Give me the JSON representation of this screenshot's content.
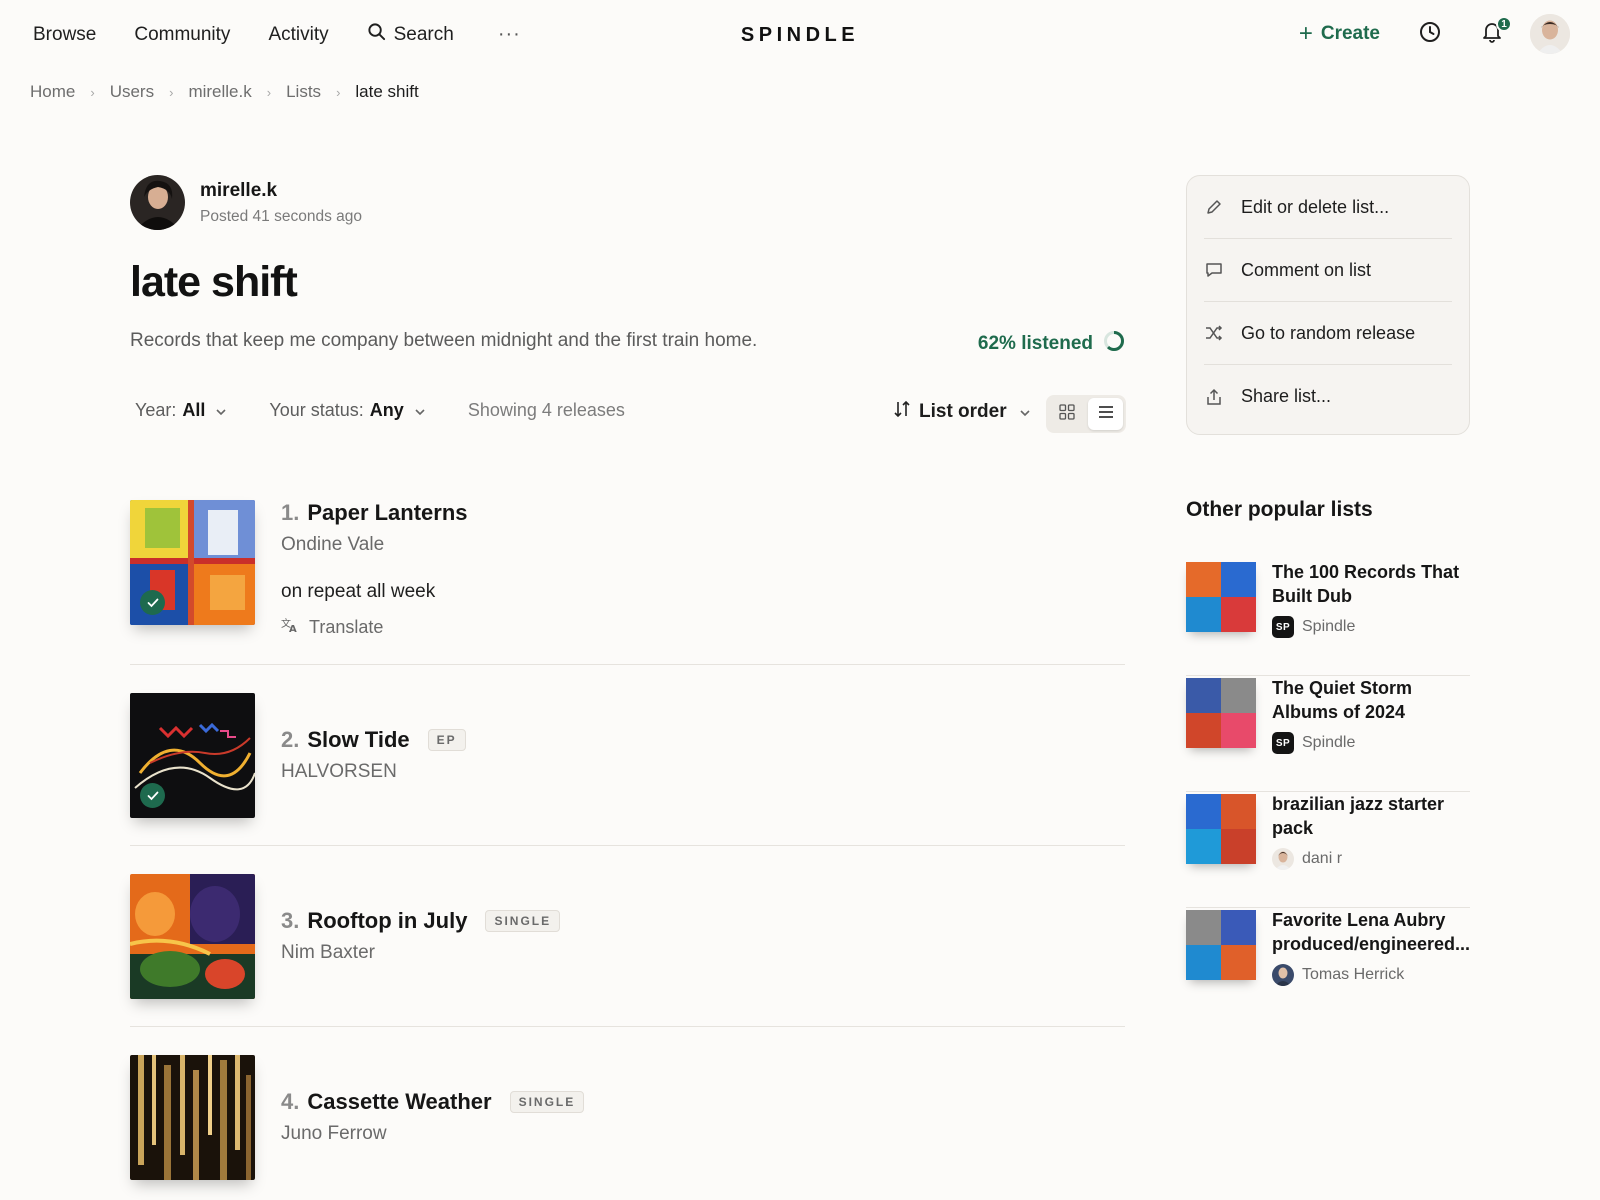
{
  "nav": {
    "browse": "Browse",
    "community": "Community",
    "activity": "Activity",
    "search": "Search",
    "more": "···",
    "logo": "SPINDLE",
    "create": "Create",
    "notification_count": "1"
  },
  "breadcrumb": {
    "items": [
      "Home",
      "Users",
      "mirelle.k",
      "Lists"
    ],
    "current": "late shift"
  },
  "list": {
    "author": "mirelle.k",
    "posted": "Posted 41 seconds ago",
    "title": "late shift",
    "description": "Records that keep me company between midnight and the first train home.",
    "progress_label": "62% listened",
    "progress_value": 0.62
  },
  "filters": {
    "year_label": "Year:",
    "year_value": "All",
    "status_label": "Your status:",
    "status_value": "Any",
    "showing": "Showing 4 releases",
    "sort": "List order",
    "view_mode": "list"
  },
  "releases": [
    {
      "num": "1.",
      "title": "Paper Lanterns",
      "artist": "Ondine Vale",
      "badge": "",
      "listened": true,
      "note": "on repeat all week",
      "translate": "Translate"
    },
    {
      "num": "2.",
      "title": "Slow Tide",
      "artist": "HALVORSEN",
      "badge": "EP",
      "listened": true
    },
    {
      "num": "3.",
      "title": "Rooftop in July",
      "artist": "Nim Baxter",
      "badge": "SINGLE",
      "listened": false
    },
    {
      "num": "4.",
      "title": "Cassette Weather",
      "artist": "Juno Ferrow",
      "badge": "SINGLE",
      "listened": false
    }
  ],
  "actions": [
    {
      "label": "Edit or delete list...",
      "icon": "pencil-icon"
    },
    {
      "label": "Comment on list",
      "icon": "comment-icon"
    },
    {
      "label": "Go to random release",
      "icon": "shuffle-icon"
    },
    {
      "label": "Share list...",
      "icon": "share-icon"
    }
  ],
  "popular": {
    "heading": "Other popular lists",
    "lists": [
      {
        "title": "The 100 Records That Built Dub",
        "by": "Spindle",
        "by_badge": "SP"
      },
      {
        "title": "The Quiet Storm Albums of 2024",
        "by": "Spindle",
        "by_badge": "SP"
      },
      {
        "title": "brazilian jazz starter pack",
        "by": "dani r"
      },
      {
        "title": "Favorite Lena Aubry produced/engineered...",
        "by": "Tomas Herrick"
      }
    ]
  },
  "colors": {
    "accent": "#1f6b4d",
    "background": "#fcfbf9",
    "text": "#1d1d1d",
    "muted": "#6a6a6a"
  }
}
